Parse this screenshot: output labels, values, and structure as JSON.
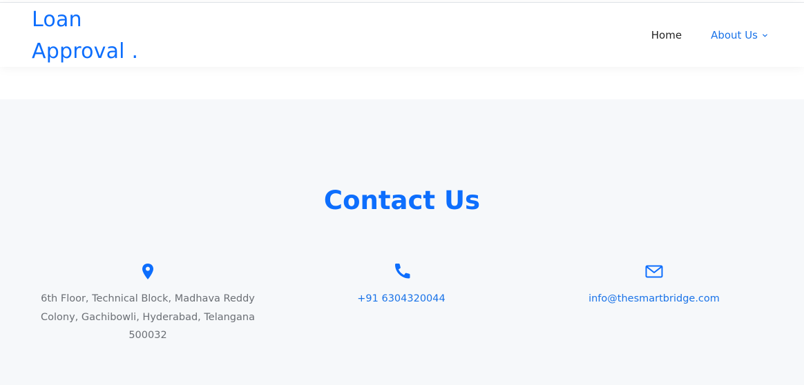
{
  "brand": {
    "line1": "Loan",
    "line2": "Approval ."
  },
  "nav": {
    "home": "Home",
    "about": "About Us"
  },
  "contact": {
    "title": "Contact Us",
    "address": "6th Floor, Technical Block, Madhava Reddy Colony, Gachibowli, Hyderabad, Telangana 500032",
    "phone": "+91 6304320044",
    "email": "info@thesmartbridge.com"
  },
  "colors": {
    "accent": "#0d6efd",
    "link": "#1a73e8",
    "section_bg": "#f6f8fa",
    "muted_text": "#6b6f75"
  },
  "icons": {
    "address": "map-marker-icon",
    "phone": "phone-icon",
    "email": "envelope-icon",
    "dropdown": "chevron-down-icon"
  }
}
